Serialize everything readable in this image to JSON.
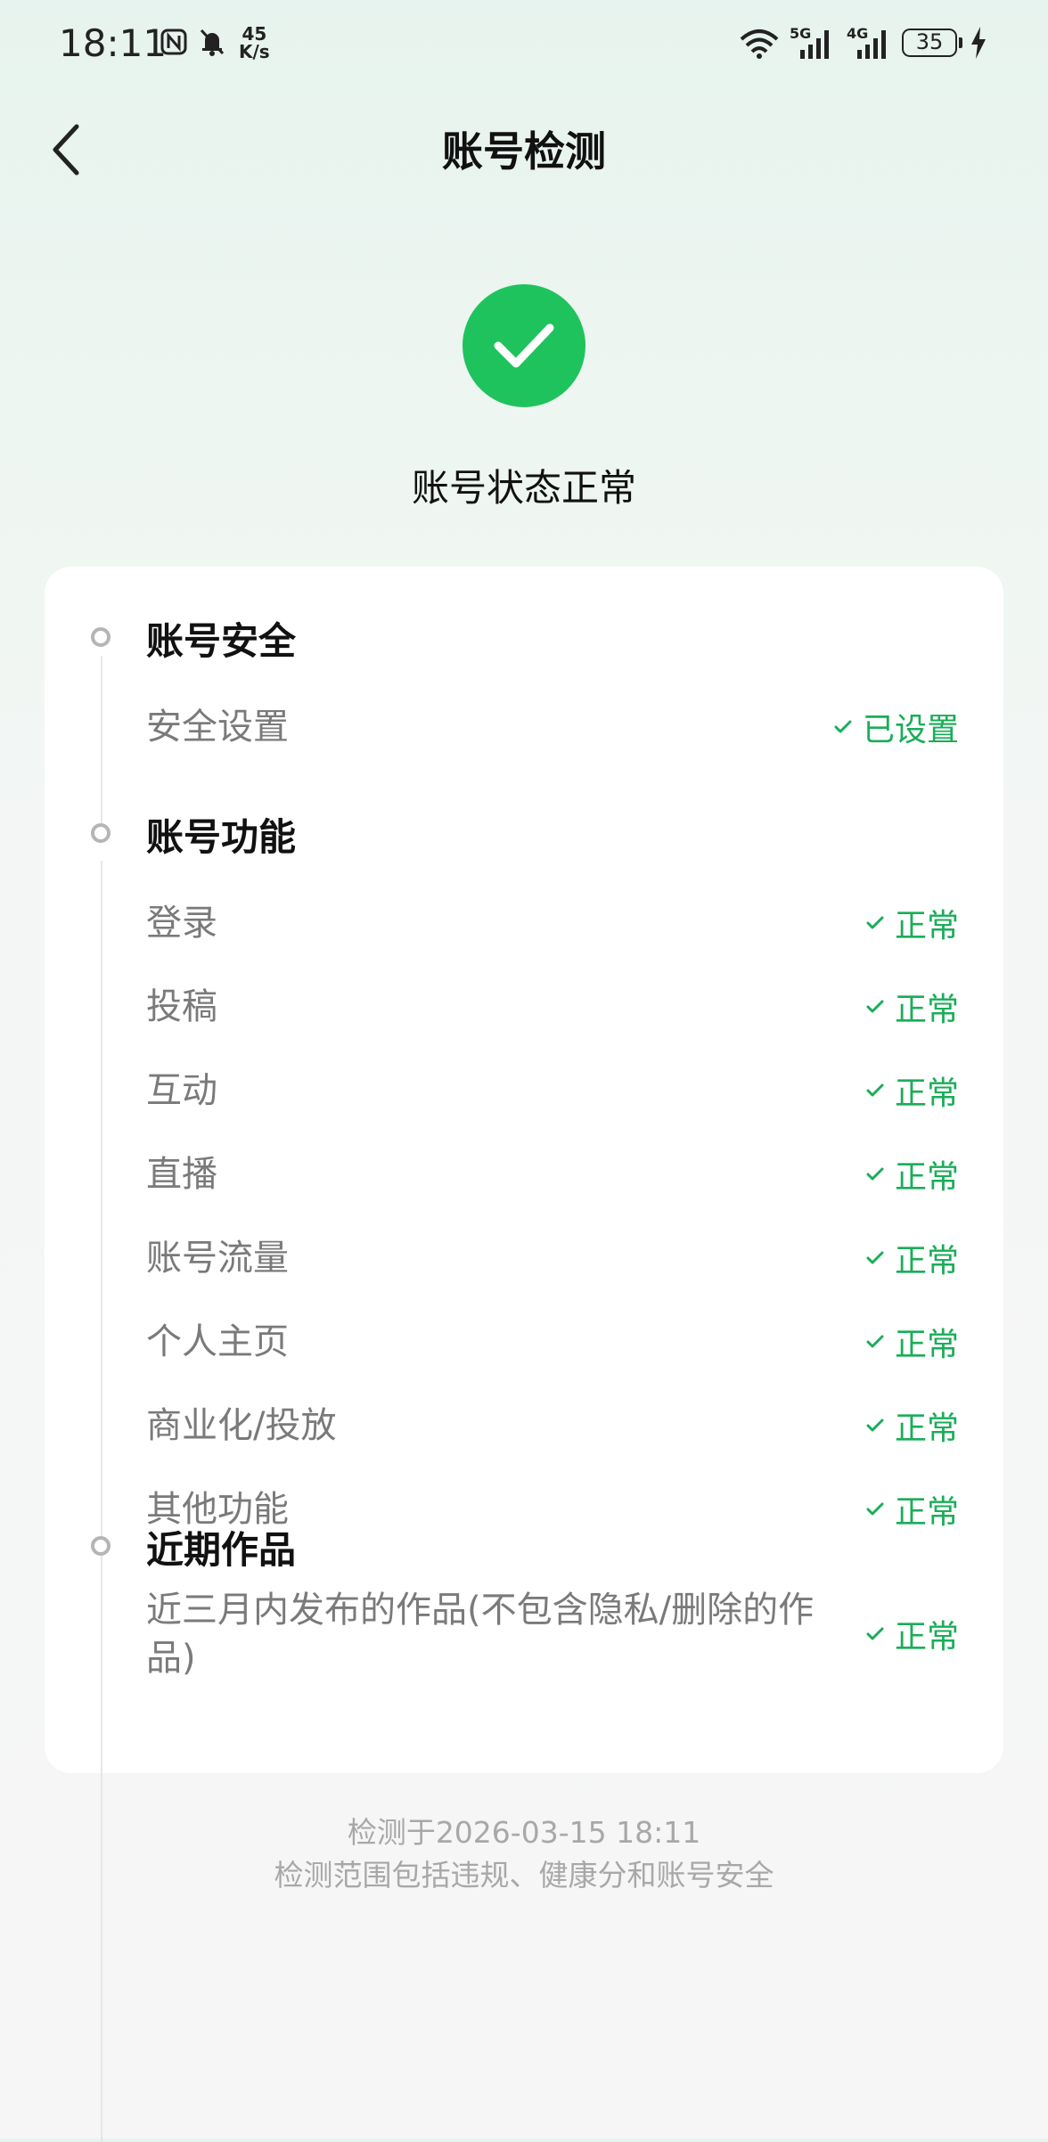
{
  "status_bar": {
    "time": "18:11",
    "speed_top": "45",
    "speed_bottom": "K/s",
    "net1": "5G",
    "net2": "4G",
    "battery": "35",
    "icons": [
      "nfc-icon",
      "bell-mute-icon",
      "wifi-icon",
      "signal-icon",
      "battery-icon",
      "charging-icon"
    ]
  },
  "nav": {
    "title": "账号检测"
  },
  "status": {
    "text": "账号状态正常",
    "color": "#1fc35d"
  },
  "sections": [
    {
      "title": "账号安全",
      "items": [
        {
          "label": "安全设置",
          "status": "已设置"
        }
      ]
    },
    {
      "title": "账号功能",
      "items": [
        {
          "label": "登录",
          "status": "正常"
        },
        {
          "label": "投稿",
          "status": "正常"
        },
        {
          "label": "互动",
          "status": "正常"
        },
        {
          "label": "直播",
          "status": "正常"
        },
        {
          "label": "账号流量",
          "status": "正常"
        },
        {
          "label": "个人主页",
          "status": "正常"
        },
        {
          "label": "商业化/投放",
          "status": "正常"
        },
        {
          "label": "其他功能",
          "status": "正常"
        }
      ]
    },
    {
      "title": "近期作品",
      "items": [
        {
          "label": "近三月内发布的作品(不包含隐私/删除的作品)",
          "status": "正常"
        }
      ]
    }
  ],
  "footer": {
    "checked_at": "检测于2026-03-15 18:11",
    "scope": "检测范围包括违规、健康分和账号安全"
  },
  "accent_color": "#1aad58"
}
